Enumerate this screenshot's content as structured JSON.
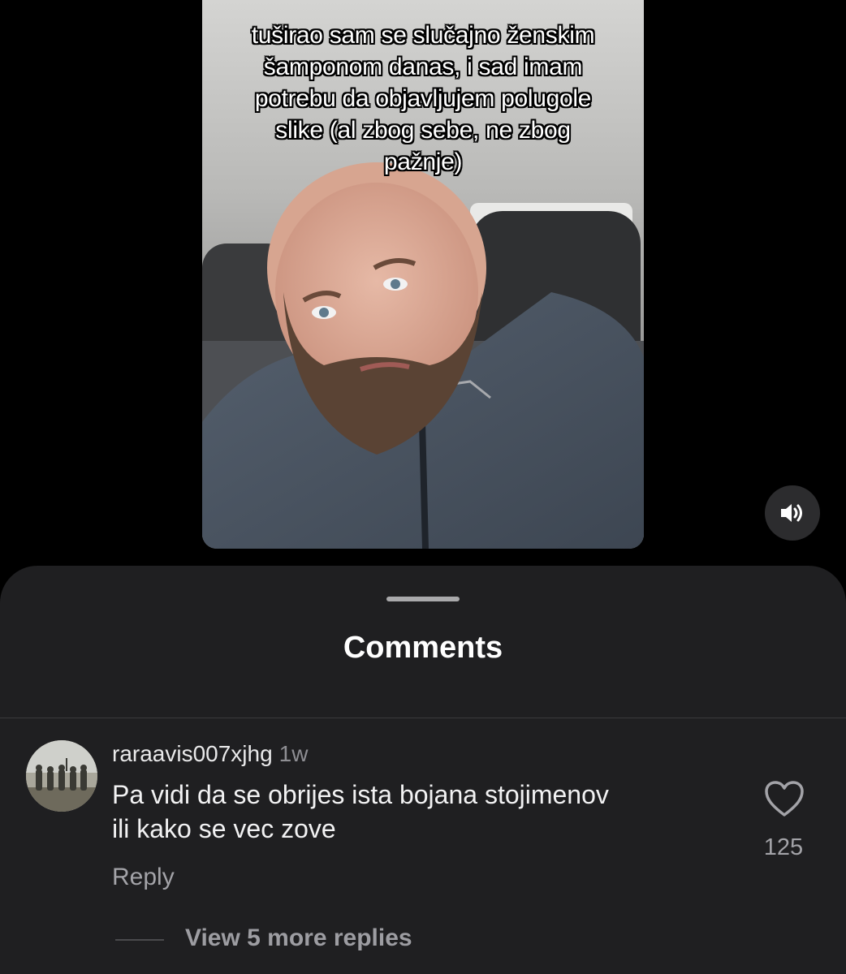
{
  "post": {
    "caption": "tuširao sam se slučajno ženskim\nšamponom danas, i sad imam\npotrebu da objavljujem  polugole\nslike (al zbog sebe, ne zbog\npažnje)",
    "sound_icon": "speaker-volume-icon"
  },
  "comments_sheet": {
    "title": "Comments",
    "comments": [
      {
        "username": "raraavis007xjhg",
        "time": "1w",
        "text": "Pa vidi da se obrijes ista bojana stojimenov\nili kako se vec zove",
        "reply_label": "Reply",
        "like_icon": "heart-icon",
        "like_count": "125",
        "view_replies_label": "View 5 more replies"
      }
    ]
  },
  "colors": {
    "background": "#000000",
    "sheet": "#1f1f21",
    "secondary_text": "#a3a3a8"
  }
}
